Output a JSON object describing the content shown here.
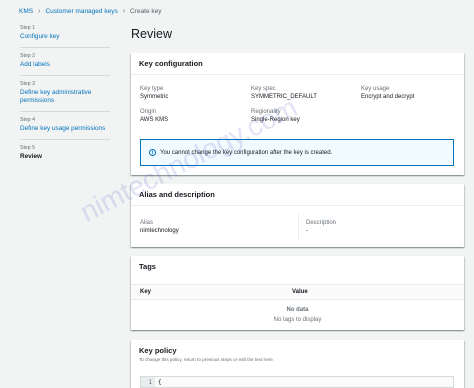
{
  "breadcrumb": {
    "items": [
      "KMS",
      "Customer managed keys",
      "Create key"
    ]
  },
  "steps": [
    {
      "num": "Step 1",
      "label": "Configure key"
    },
    {
      "num": "Step 2",
      "label": "Add labels"
    },
    {
      "num": "Step 3",
      "label": "Define key administrative permissions"
    },
    {
      "num": "Step 4",
      "label": "Define key usage permissions"
    },
    {
      "num": "Step 5",
      "label": "Review"
    }
  ],
  "page_title": "Review",
  "key_configuration": {
    "title": "Key configuration",
    "fields": {
      "key_type": {
        "label": "Key type",
        "value": "Symmetric"
      },
      "key_spec": {
        "label": "Key spec",
        "value": "SYMMETRIC_DEFAULT"
      },
      "key_usage": {
        "label": "Key usage",
        "value": "Encrypt and decrypt"
      },
      "origin": {
        "label": "Origin",
        "value": "AWS KMS"
      },
      "regionality": {
        "label": "Regionality",
        "value": "Single-Region key"
      }
    },
    "info": "You cannot change the key configuration after the key is created."
  },
  "alias_description": {
    "title": "Alias and description",
    "alias": {
      "label": "Alias",
      "value": "nimtechnology"
    },
    "description": {
      "label": "Description",
      "value": "-"
    }
  },
  "tags": {
    "title": "Tags",
    "columns": [
      "Key",
      "Value"
    ],
    "empty_title": "No data",
    "empty_desc": "No tags to display"
  },
  "key_policy": {
    "title": "Key policy",
    "subtitle": "To change this policy, return to previous steps or edit the text here.",
    "line_number": "1",
    "first_line": "{"
  },
  "watermark": "nimtechnology.com"
}
